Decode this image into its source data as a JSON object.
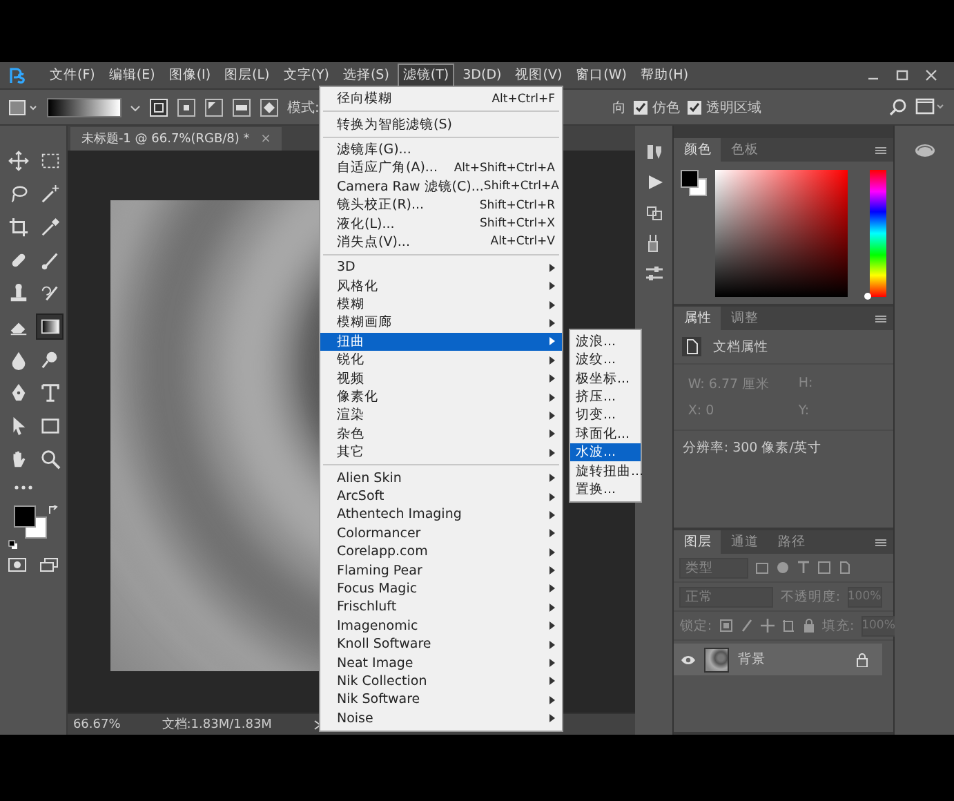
{
  "menubar": {
    "items": [
      {
        "label": "文件(F)",
        "selected": false
      },
      {
        "label": "编辑(E)",
        "selected": false
      },
      {
        "label": "图像(I)",
        "selected": false
      },
      {
        "label": "图层(L)",
        "selected": false
      },
      {
        "label": "文字(Y)",
        "selected": false
      },
      {
        "label": "选择(S)",
        "selected": false
      },
      {
        "label": "滤镜(T)",
        "selected": true
      },
      {
        "label": "3D(D)",
        "selected": false
      },
      {
        "label": "视图(V)",
        "selected": false
      },
      {
        "label": "窗口(W)",
        "selected": false
      },
      {
        "label": "帮助(H)",
        "selected": false
      }
    ]
  },
  "options_bar": {
    "mode_label": "模式:",
    "cut_label": "向",
    "checkboxes": [
      {
        "label": "仿色",
        "checked": true
      },
      {
        "label": "透明区域",
        "checked": true
      }
    ]
  },
  "document_tab": {
    "title": "未标题-1 @ 66.7%(RGB/8) *",
    "close": "×"
  },
  "tools": [
    {
      "selected": false
    },
    {
      "selected": false
    },
    {
      "selected": false
    },
    {
      "selected": false
    },
    {
      "selected": false
    },
    {
      "selected": false
    },
    {
      "selected": false
    },
    {
      "selected": false
    },
    {
      "selected": false
    },
    {
      "selected": false
    },
    {
      "selected": false
    },
    {
      "selected": true
    },
    {
      "selected": false
    },
    {
      "selected": false
    },
    {
      "selected": false
    },
    {
      "selected": false
    },
    {
      "selected": false
    },
    {
      "selected": false
    },
    {
      "selected": false
    },
    {
      "selected": false
    }
  ],
  "status_bar": {
    "zoom": "66.67%",
    "doc_size": "文档:1.83M/1.83M"
  },
  "color_panel": {
    "tabs": [
      {
        "label": "颜色",
        "selected": true
      },
      {
        "label": "色板",
        "selected": false
      }
    ],
    "hue": {
      "level": 0
    }
  },
  "properties_panel": {
    "tabs": [
      {
        "label": "属性",
        "selected": true
      },
      {
        "label": "调整",
        "selected": false
      }
    ],
    "title": "文档属性",
    "fields": [
      "W: 6.77 厘米",
      "H:",
      "X: 0",
      "Y:"
    ],
    "resolution": "分辨率: 300 像素/英寸"
  },
  "layers_panel": {
    "tabs": [
      {
        "label": "图层",
        "selected": true
      },
      {
        "label": "通道",
        "selected": false
      },
      {
        "label": "路径",
        "selected": false
      }
    ],
    "filter": "类型",
    "blend_mode": "正常",
    "opacity_label": "不透明度:",
    "opacity": "100%",
    "lock_label": "锁定:",
    "fill_label": "填充:",
    "fill": "100%",
    "layers": [
      {
        "name": "背景",
        "visible": true,
        "locked": true
      }
    ]
  },
  "filter_menu": {
    "groups": [
      [
        {
          "label": "径向模糊",
          "shortcut": "Alt+Ctrl+F",
          "kind": "command",
          "selected": false
        }
      ],
      [
        {
          "label": "转换为智能滤镜(S)",
          "kind": "command",
          "selected": false
        }
      ],
      [
        {
          "label": "滤镜库(G)...",
          "kind": "command",
          "selected": false
        },
        {
          "label": "自适应广角(A)...",
          "shortcut": "Alt+Shift+Ctrl+A",
          "kind": "command",
          "selected": false
        },
        {
          "label": "Camera Raw 滤镜(C)...",
          "shortcut": "Shift+Ctrl+A",
          "kind": "command",
          "selected": false
        },
        {
          "label": "镜头校正(R)...",
          "shortcut": "Shift+Ctrl+R",
          "kind": "command",
          "selected": false
        },
        {
          "label": "液化(L)...",
          "shortcut": "Shift+Ctrl+X",
          "kind": "command",
          "selected": false
        },
        {
          "label": "消失点(V)...",
          "shortcut": "Alt+Ctrl+V",
          "kind": "command",
          "selected": false
        }
      ],
      [
        {
          "label": "3D",
          "kind": "submenu",
          "selected": false
        },
        {
          "label": "风格化",
          "kind": "submenu",
          "selected": false
        },
        {
          "label": "模糊",
          "kind": "submenu",
          "selected": false
        },
        {
          "label": "模糊画廊",
          "kind": "submenu",
          "selected": false
        },
        {
          "label": "扭曲",
          "kind": "submenu",
          "selected": true
        },
        {
          "label": "锐化",
          "kind": "submenu",
          "selected": false
        },
        {
          "label": "视频",
          "kind": "submenu",
          "selected": false
        },
        {
          "label": "像素化",
          "kind": "submenu",
          "selected": false
        },
        {
          "label": "渲染",
          "kind": "submenu",
          "selected": false
        },
        {
          "label": "杂色",
          "kind": "submenu",
          "selected": false
        },
        {
          "label": "其它",
          "kind": "submenu",
          "selected": false
        }
      ],
      [
        {
          "label": "Alien Skin",
          "kind": "submenu",
          "selected": false
        },
        {
          "label": "ArcSoft",
          "kind": "submenu",
          "selected": false
        },
        {
          "label": "Athentech Imaging",
          "kind": "submenu",
          "selected": false
        },
        {
          "label": "Colormancer",
          "kind": "submenu",
          "selected": false
        },
        {
          "label": "Corelapp.com",
          "kind": "submenu",
          "selected": false
        },
        {
          "label": "Flaming Pear",
          "kind": "submenu",
          "selected": false
        },
        {
          "label": "Focus Magic",
          "kind": "submenu",
          "selected": false
        },
        {
          "label": "Frischluft",
          "kind": "submenu",
          "selected": false
        },
        {
          "label": "Imagenomic",
          "kind": "submenu",
          "selected": false
        },
        {
          "label": "Knoll Software",
          "kind": "submenu",
          "selected": false
        },
        {
          "label": "Neat Image",
          "kind": "submenu",
          "selected": false
        },
        {
          "label": "Nik Collection",
          "kind": "submenu",
          "selected": false
        },
        {
          "label": "Nik Software",
          "kind": "submenu",
          "selected": false
        },
        {
          "label": "Noise",
          "kind": "submenu",
          "selected": false
        }
      ]
    ]
  },
  "submenu": {
    "items": [
      {
        "label": "波浪...",
        "selected": false
      },
      {
        "label": "波纹...",
        "selected": false
      },
      {
        "label": "极坐标...",
        "selected": false
      },
      {
        "label": "挤压...",
        "selected": false
      },
      {
        "label": "切变...",
        "selected": false
      },
      {
        "label": "球面化...",
        "selected": false
      },
      {
        "label": "水波...",
        "selected": true
      },
      {
        "label": "旋转扭曲...",
        "selected": false
      },
      {
        "label": "置换...",
        "selected": false
      }
    ]
  }
}
